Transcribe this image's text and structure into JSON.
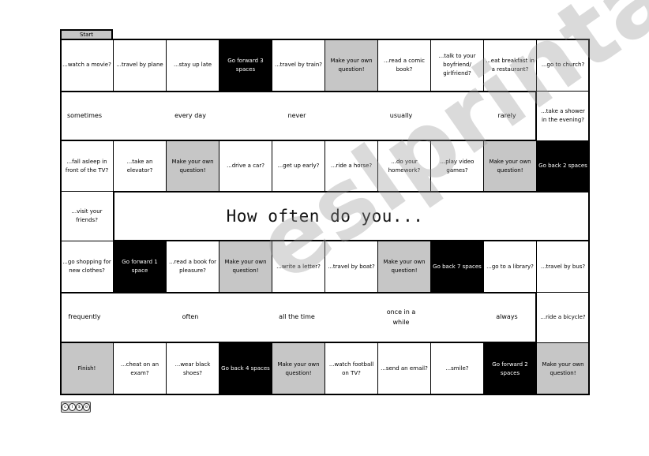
{
  "start_label": "Start",
  "title": "How often do you...",
  "license_badge": "cc by nc sa",
  "watermark": "eslprintables.com",
  "colors": {
    "gray_cell": "#c6c6c6",
    "black_cell": "#000000",
    "white_cell": "#ffffff"
  },
  "rows": {
    "row1": [
      {
        "text": "...watch a movie?",
        "style": "white"
      },
      {
        "text": "...travel by plane",
        "style": "white"
      },
      {
        "text": "...stay up late",
        "style": "white"
      },
      {
        "text": "Go forward 3 spaces",
        "style": "black"
      },
      {
        "text": "...travel by train?",
        "style": "white"
      },
      {
        "text": "Make your own question!",
        "style": "gray"
      },
      {
        "text": "...read a comic book?",
        "style": "white"
      },
      {
        "text": "...talk to your boyfriend/ girlfriend?",
        "style": "white"
      },
      {
        "text": "...eat breakfast in a restaurant?",
        "style": "white"
      },
      {
        "text": "...go to church?",
        "style": "white"
      }
    ],
    "row2_right": {
      "text": "...take a shower in the evening?",
      "style": "white"
    },
    "row3": [
      {
        "text": "...fall asleep in front of the TV?",
        "style": "white"
      },
      {
        "text": "...take an elevator?",
        "style": "white"
      },
      {
        "text": "Make your own question!",
        "style": "gray"
      },
      {
        "text": "...drive a car?",
        "style": "white"
      },
      {
        "text": "...get up early?",
        "style": "white"
      },
      {
        "text": "...ride a horse?",
        "style": "white"
      },
      {
        "text": "...do your homework?",
        "style": "white"
      },
      {
        "text": "...play video games?",
        "style": "white"
      },
      {
        "text": "Make your own question!",
        "style": "gray"
      },
      {
        "text": "Go back 2 spaces",
        "style": "black"
      }
    ],
    "row4_left": {
      "text": "...visit your friends?",
      "style": "white"
    },
    "row5": [
      {
        "text": "...go shopping for new clothes?",
        "style": "white"
      },
      {
        "text": "Go forward 1 space",
        "style": "black"
      },
      {
        "text": "...read a book for pleasure?",
        "style": "white"
      },
      {
        "text": "Make your own question!",
        "style": "gray"
      },
      {
        "text": "...write a letter?",
        "style": "white"
      },
      {
        "text": "...travel by boat?",
        "style": "white"
      },
      {
        "text": "Make your own question!",
        "style": "gray"
      },
      {
        "text": "Go back 7 spaces",
        "style": "black"
      },
      {
        "text": "...go to a library?",
        "style": "white"
      },
      {
        "text": "...travel by bus?",
        "style": "white"
      }
    ],
    "row6_right": {
      "text": "...ride a bicycle?",
      "style": "white"
    },
    "row7": [
      {
        "text": "Finish!",
        "style": "gray"
      },
      {
        "text": "...cheat on an exam?",
        "style": "white"
      },
      {
        "text": "...wear black shoes?",
        "style": "white"
      },
      {
        "text": "Go back 4 spaces",
        "style": "black"
      },
      {
        "text": "Make your own question!",
        "style": "gray"
      },
      {
        "text": "...watch football on TV?",
        "style": "white"
      },
      {
        "text": "...send an email?",
        "style": "white"
      },
      {
        "text": "...smile?",
        "style": "white"
      },
      {
        "text": "Go forward 2 spaces",
        "style": "black"
      },
      {
        "text": "Make your own question!",
        "style": "gray"
      }
    ]
  },
  "adverbs_row2": [
    "sometimes",
    "every day",
    "never",
    "usually",
    "rarely"
  ],
  "adverbs_row6": [
    "frequently",
    "often",
    "all the time",
    "once in a while",
    "always"
  ]
}
